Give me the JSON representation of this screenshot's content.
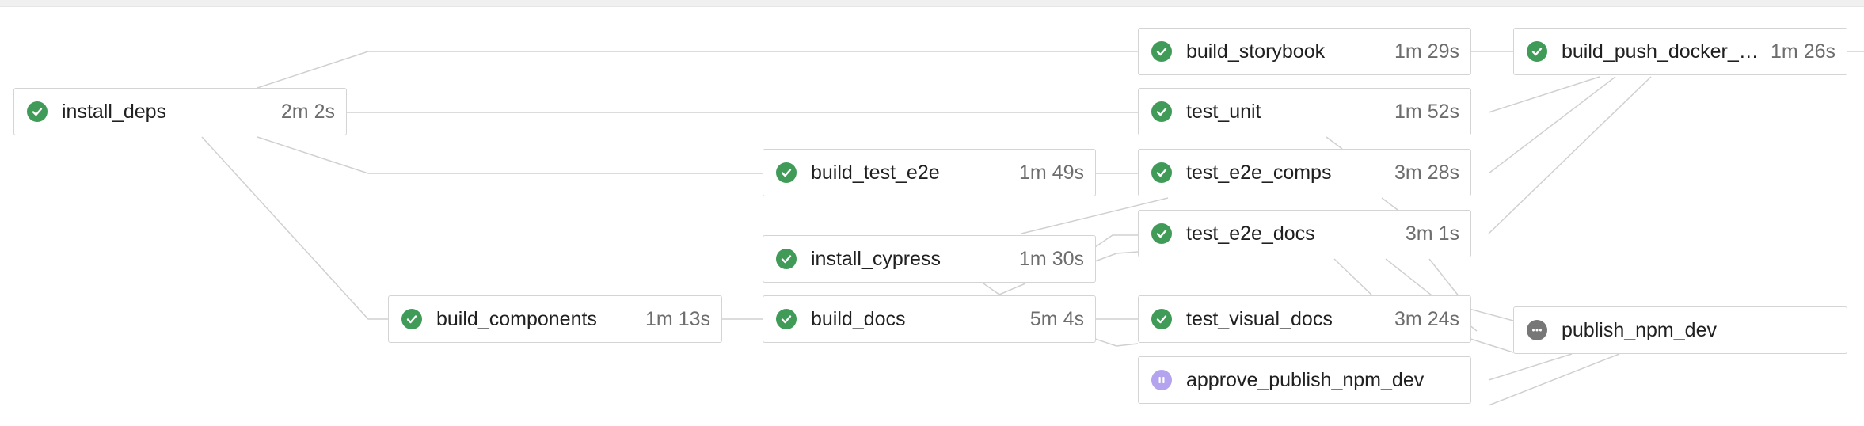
{
  "jobs": {
    "install_deps": {
      "name": "install_deps",
      "duration": "2m 2s",
      "status": "success",
      "icon": "check-icon"
    },
    "build_components": {
      "name": "build_components",
      "duration": "1m 13s",
      "status": "success",
      "icon": "check-icon"
    },
    "build_test_e2e": {
      "name": "build_test_e2e",
      "duration": "1m 49s",
      "status": "success",
      "icon": "check-icon"
    },
    "install_cypress": {
      "name": "install_cypress",
      "duration": "1m 30s",
      "status": "success",
      "icon": "check-icon"
    },
    "build_docs": {
      "name": "build_docs",
      "duration": "5m 4s",
      "status": "success",
      "icon": "check-icon"
    },
    "build_storybook": {
      "name": "build_storybook",
      "duration": "1m 29s",
      "status": "success",
      "icon": "check-icon"
    },
    "test_unit": {
      "name": "test_unit",
      "duration": "1m 52s",
      "status": "success",
      "icon": "check-icon"
    },
    "test_e2e_comps": {
      "name": "test_e2e_comps",
      "duration": "3m 28s",
      "status": "success",
      "icon": "check-icon"
    },
    "test_e2e_docs": {
      "name": "test_e2e_docs",
      "duration": "3m 1s",
      "status": "success",
      "icon": "check-icon"
    },
    "test_visual_docs": {
      "name": "test_visual_docs",
      "duration": "3m 24s",
      "status": "success",
      "icon": "check-icon"
    },
    "approve_publish_npm_dev": {
      "name": "approve_publish_npm_dev",
      "duration": "",
      "status": "manual",
      "icon": "pause-icon"
    },
    "build_push_docker_e": {
      "name": "build_push_docker_e…",
      "duration": "1m 26s",
      "status": "success",
      "icon": "check-icon"
    },
    "publish_npm_dev": {
      "name": "publish_npm_dev",
      "duration": "",
      "status": "running",
      "icon": "more-dots-icon"
    }
  },
  "colors": {
    "success": "#3f9b57",
    "manual": "#b4a3ee",
    "running": "#777777",
    "connector": "#d0d0d0",
    "border": "#d4d4d4"
  }
}
